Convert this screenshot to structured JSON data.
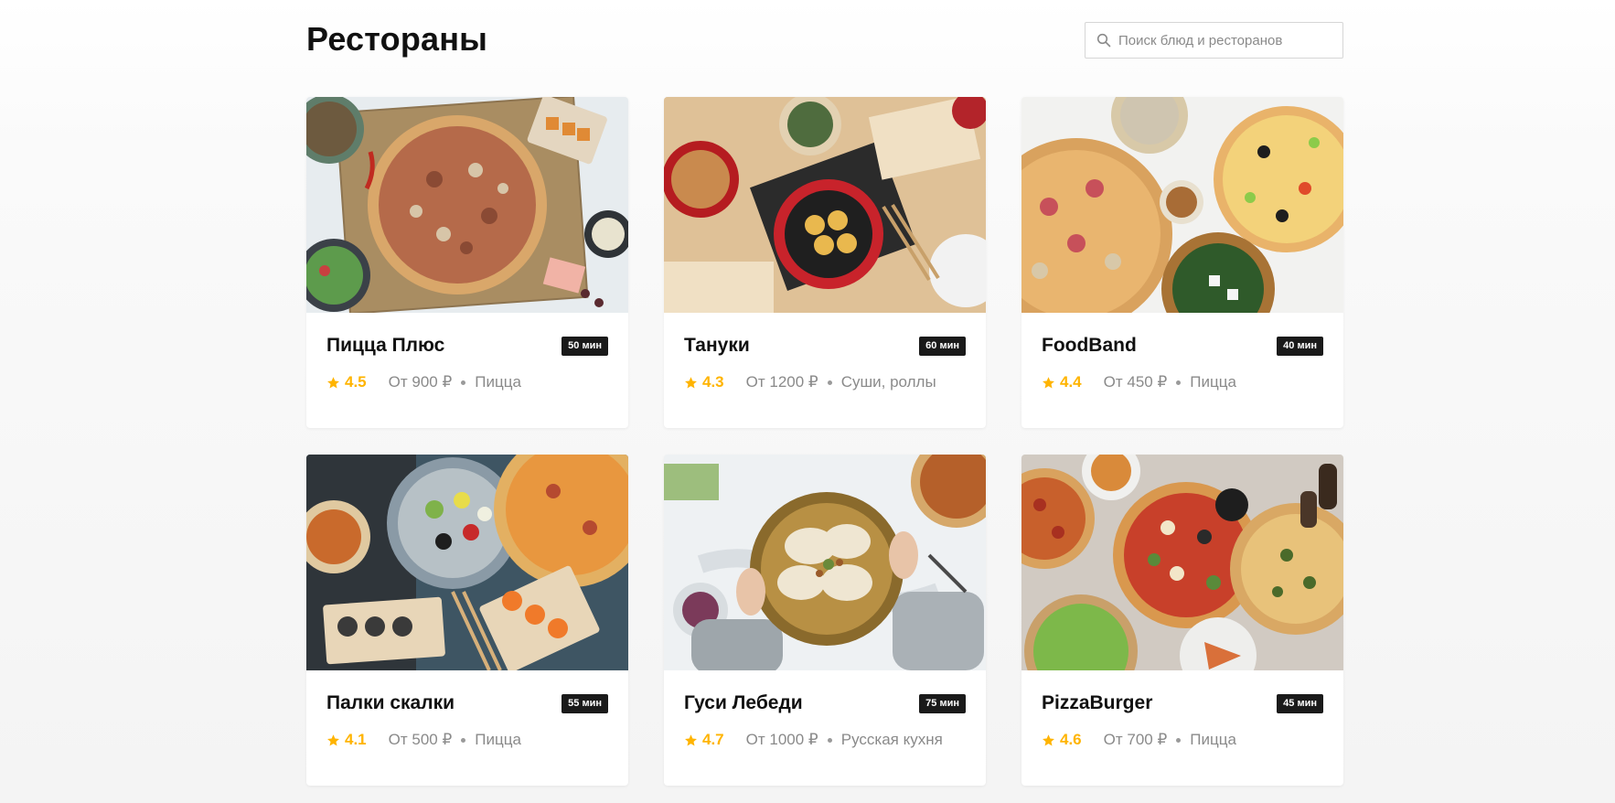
{
  "header": {
    "title": "Рестораны",
    "search_placeholder": "Поиск блюд и ресторанов",
    "search_icon": "search-icon"
  },
  "colors": {
    "rating": "#ffb400",
    "badge_bg": "#1a1a1a",
    "muted_text": "#8a8a8a"
  },
  "restaurants": [
    {
      "name": "Пицца Плюс",
      "time": "50 мин",
      "rating": "4.5",
      "price": "От 900 ₽",
      "cuisine": "Пицца",
      "image": "pizza-and-sushi-photo"
    },
    {
      "name": "Тануки",
      "time": "60 мин",
      "rating": "4.3",
      "price": "От 1200 ₽",
      "cuisine": "Суши, роллы",
      "image": "asian-dumplings-photo"
    },
    {
      "name": "FoodBand",
      "time": "40 мин",
      "rating": "4.4",
      "price": "От 450 ₽",
      "cuisine": "Пицца",
      "image": "pizza-spread-photo"
    },
    {
      "name": "Палки скалки",
      "time": "55 мин",
      "rating": "4.1",
      "price": "От 500 ₽",
      "cuisine": "Пицца",
      "image": "salad-sushi-pizza-photo"
    },
    {
      "name": "Гуси Лебеди",
      "time": "75 мин",
      "rating": "4.7",
      "price": "От 1000 ₽",
      "cuisine": "Русская кухня",
      "image": "dumplings-bowl-photo"
    },
    {
      "name": "PizzaBurger",
      "time": "45 мин",
      "rating": "4.6",
      "price": "От 700 ₽",
      "cuisine": "Пицца",
      "image": "pizzas-on-table-photo"
    }
  ]
}
